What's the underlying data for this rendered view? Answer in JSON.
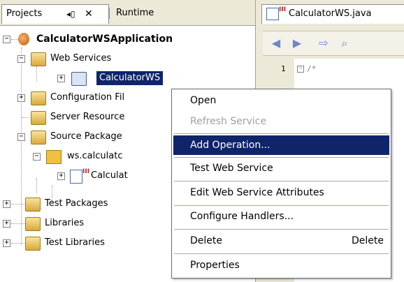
{
  "left_panel": {
    "tabs": {
      "projects": "Projects",
      "projects_ctrl": "◂▯",
      "close": "✕",
      "runtime": "Runtime"
    },
    "tree": {
      "root": "CalculatorWSApplication",
      "web_services": "Web Services",
      "calculator_ws": "CalculatorWS",
      "configuration_files": "Configuration Fil",
      "server_resources": "Server Resource",
      "source_packages": "Source Package",
      "package_name": "ws.calculatc",
      "class_file": "Calculat",
      "test_packages": "Test Packages",
      "libraries": "Libraries",
      "test_libraries": "Test Libraries"
    }
  },
  "editor": {
    "tab_title": "CalculatorWS.java",
    "line_number": "1",
    "code_line": "/*",
    "icons": [
      "back-icon",
      "forward-icon",
      "goto-source-icon",
      "find-icon"
    ]
  },
  "context_menu": {
    "items": [
      {
        "label": "Open",
        "enabled": true
      },
      {
        "label": "Refresh Service",
        "enabled": false
      },
      {
        "label": "Add Operation...",
        "enabled": true,
        "selected": true
      },
      {
        "label": "Test Web Service",
        "enabled": true
      },
      {
        "label": "Edit Web Service Attributes",
        "enabled": true
      },
      {
        "label": "Configure Handlers...",
        "enabled": true
      },
      {
        "label": "Delete",
        "shortcut": "Delete",
        "enabled": true
      },
      {
        "label": "Properties",
        "enabled": true
      }
    ]
  },
  "colors": {
    "selection": "#10246a",
    "tree_selection": "#10246a",
    "chrome": "#ece9d8"
  }
}
